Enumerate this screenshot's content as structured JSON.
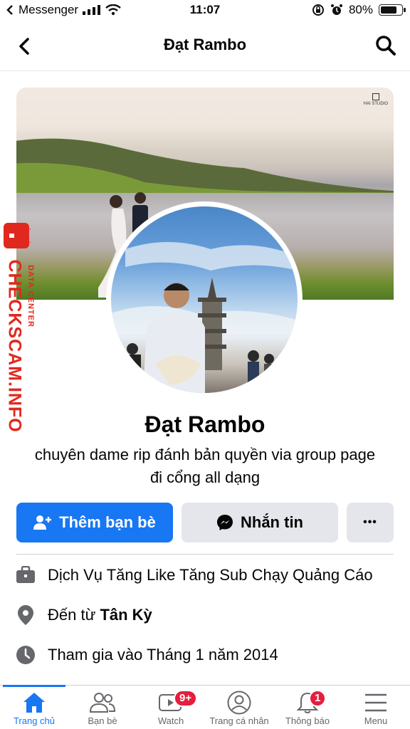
{
  "status_bar": {
    "app": "Messenger",
    "time": "11:07",
    "battery": "80%",
    "battery_level": 0.8
  },
  "header": {
    "title": "Đạt Rambo"
  },
  "watermark": {
    "text": "CHECKSCAM.INFO",
    "sub": "DATA CENTER"
  },
  "profile": {
    "name": "Đạt Rambo",
    "bio_line1": "chuyên dame rip đánh bản quyền via group page",
    "bio_line2": "đi cổng all dạng"
  },
  "actions": {
    "add_friend": "Thêm bạn bè",
    "message": "Nhắn tin",
    "more": "•••"
  },
  "info": {
    "work": "Dịch Vụ Tăng Like Tăng Sub Chạy Quảng Cáo",
    "from_prefix": "Đến từ ",
    "from_place": "Tân Kỳ",
    "joined": "Tham gia vào Tháng 1 năm 2014"
  },
  "tabs": [
    {
      "label": "Trang chủ",
      "icon": "home-icon",
      "active": true
    },
    {
      "label": "Bạn bè",
      "icon": "friends-icon"
    },
    {
      "label": "Watch",
      "icon": "watch-icon",
      "badge": "9+"
    },
    {
      "label": "Trang cá nhân",
      "icon": "profile-icon"
    },
    {
      "label": "Thông báo",
      "icon": "bell-icon",
      "badge": "1"
    },
    {
      "label": "Menu",
      "icon": "menu-icon"
    }
  ],
  "colors": {
    "accent": "#1877f2",
    "badge": "#e41e3f",
    "watermark": "#e1281f"
  }
}
